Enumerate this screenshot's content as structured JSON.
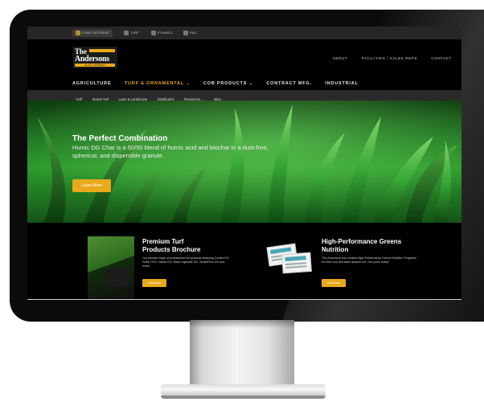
{
  "utility_bar": {
    "items": [
      {
        "label": "PLANT NUTRIENT",
        "selected": true
      },
      {
        "label": "TURF",
        "selected": false
      },
      {
        "label": "ETHANOL",
        "selected": false
      },
      {
        "label": "RAIL",
        "selected": false
      }
    ]
  },
  "brand": {
    "logo_line1": "The",
    "logo_line2": "Andersons",
    "logo_tag": "PLANT NUTRIENT"
  },
  "top_links": [
    "ABOUT",
    "FACILITIES / SALES REPS",
    "CONTACT"
  ],
  "main_nav": [
    {
      "label": "AGRICULTURE",
      "active": false
    },
    {
      "label": "TURF & ORNAMENTAL ⌄",
      "active": true
    },
    {
      "label": "COB PRODUCTS ⌄",
      "active": false
    },
    {
      "label": "CONTRACT MFG.",
      "active": false
    },
    {
      "label": "INDUSTRIAL",
      "active": false
    }
  ],
  "sub_nav": [
    "Golf",
    "Sports Turf",
    "Lawn & Landscape",
    "Distributors",
    "Resources ⌄",
    "Blog"
  ],
  "hero": {
    "title": "The Perfect Combination",
    "body": "Humic DG Char is a 50/50 blend of humic acid and biochar in a dust-free, spherical, and dispersible granule.",
    "button": "Learn More"
  },
  "promos": [
    {
      "title_line1": "Premium Turf",
      "title_line2": "Products Brochure",
      "body": "Our newest range of professional turf products featuring Contec DG, Fulfill, HYD, Humic DG, Black Ingleside DG, SmartPhos DG and more!",
      "button": "Download"
    },
    {
      "title_line1": "High-Performance Greens",
      "title_line2": "Nutrition",
      "body": "The Andersons has created High-Performance Greens Nutrition Programs for both cool and warm season turf. Get yours today!",
      "button": "Download"
    }
  ],
  "colors": {
    "accent": "#e8a91a",
    "nav_bg": "#2a2a2a",
    "hero_green": "#2d9a2d"
  }
}
